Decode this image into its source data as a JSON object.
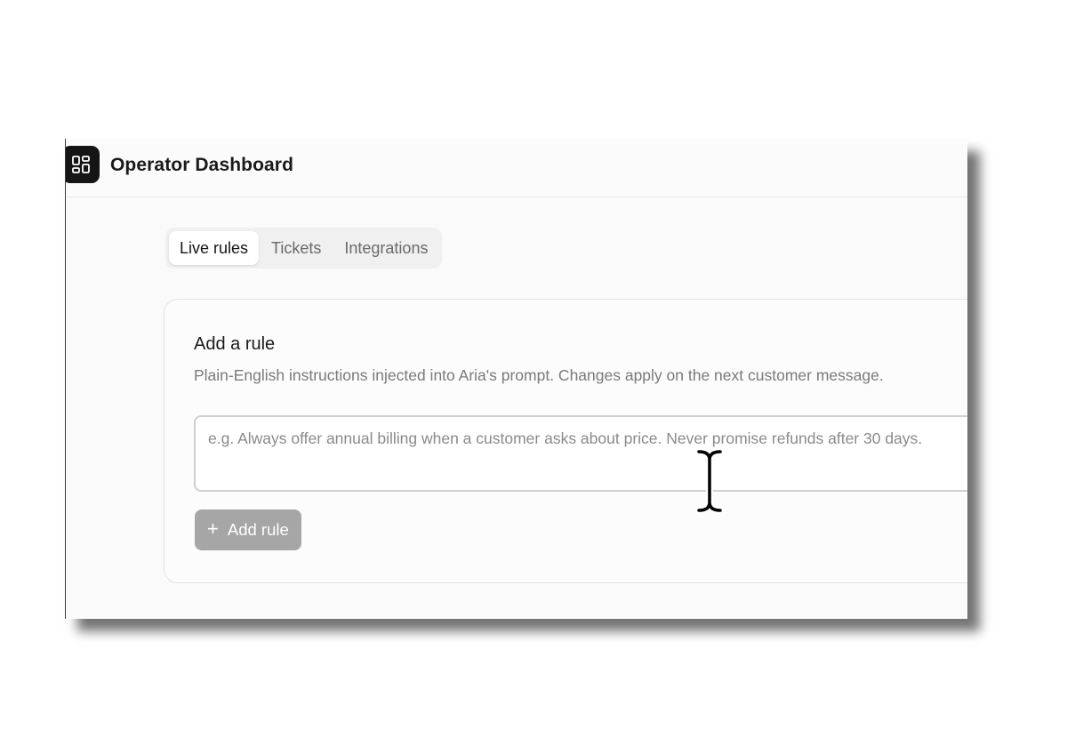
{
  "header": {
    "title": "Operator Dashboard",
    "logo_icon": "layout-grid-icon"
  },
  "tabs": [
    {
      "label": "Live rules",
      "active": true
    },
    {
      "label": "Tickets",
      "active": false
    },
    {
      "label": "Integrations",
      "active": false
    }
  ],
  "rule_card": {
    "title": "Add a rule",
    "description": "Plain-English instructions injected into Aria's prompt. Changes apply on the next customer message.",
    "input": {
      "value": "",
      "placeholder": "e.g. Always offer annual billing when a customer asks about price. Never promise refunds after 30 days."
    },
    "add_button_label": "Add rule",
    "add_button_icon": "plus-icon"
  },
  "cursor_icon": "text-cursor-icon",
  "colors": {
    "logo_bg": "#151515",
    "button_disabled": "#a6a6a6",
    "active_tab_bg": "#ffffff"
  }
}
